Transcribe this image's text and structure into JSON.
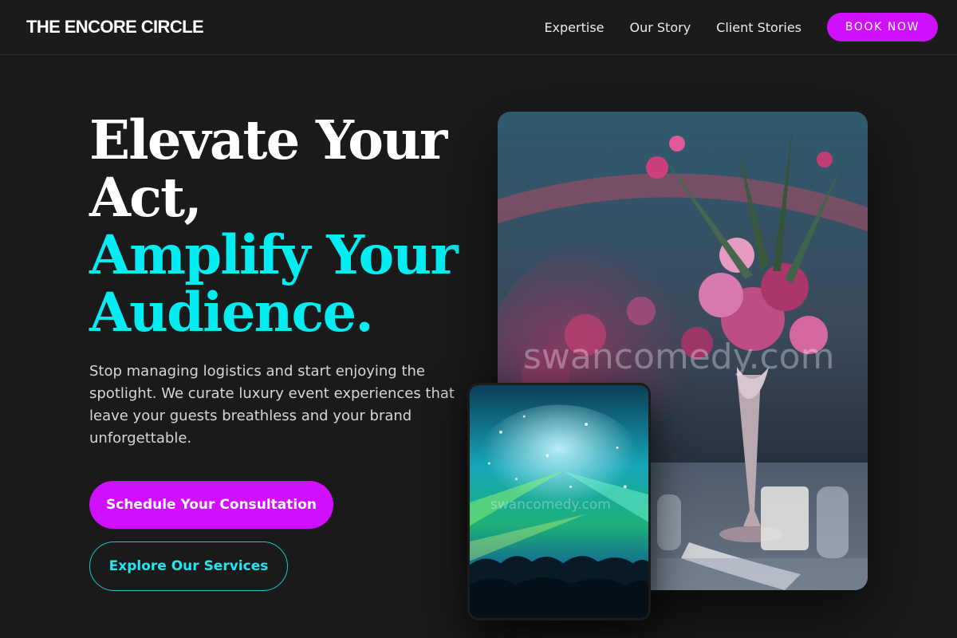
{
  "header": {
    "brand": "THE ENCORE CIRCLE",
    "nav": [
      {
        "label": "Expertise"
      },
      {
        "label": "Our Story"
      },
      {
        "label": "Client Stories"
      }
    ],
    "book_label": "BOOK NOW"
  },
  "hero": {
    "headline_line1": "Elevate Your",
    "headline_line2": "Act,",
    "headline_line3": "Amplify Your",
    "headline_line4": "Audience.",
    "subcopy": "Stop managing logistics and start enjoying the spotlight. We curate luxury event experiences that leave your guests breathless and your brand unforgettable.",
    "cta_primary": "Schedule Your Consultation",
    "cta_secondary": "Explore Our Services"
  },
  "images": {
    "main_watermark": "swancomedy.com",
    "small_watermark": "swancomedy.com"
  },
  "colors": {
    "background": "#1a1a1b",
    "accent_magenta": "#d10fff",
    "accent_cyan": "#00eef2"
  }
}
